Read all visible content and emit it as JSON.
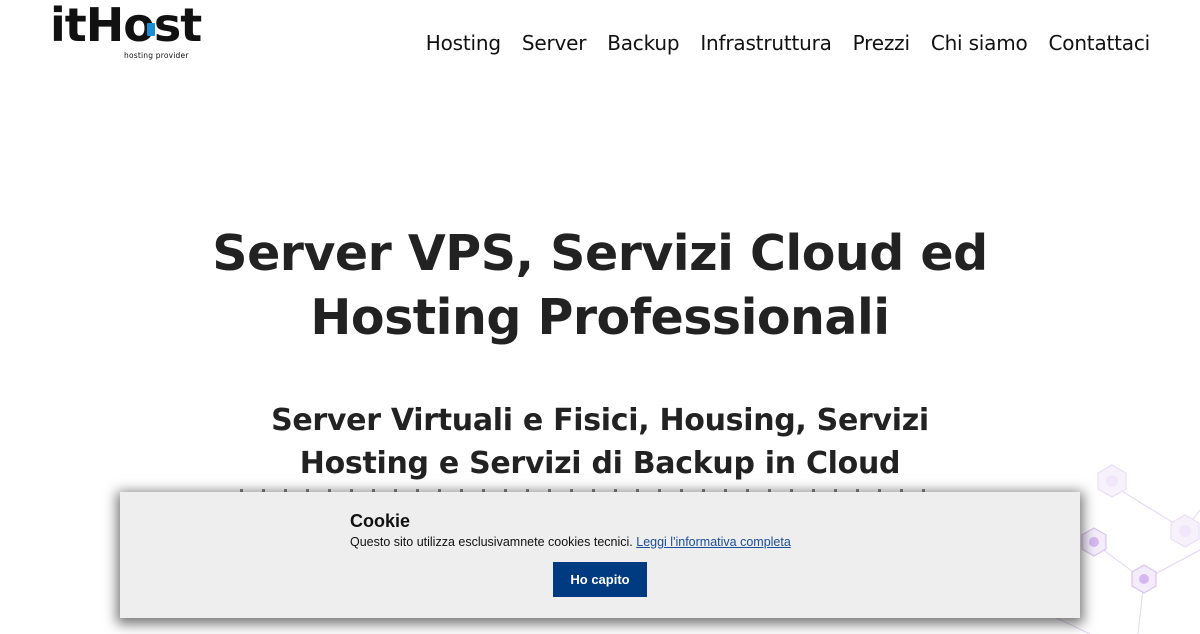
{
  "header": {
    "logo": {
      "wordmark": "itHost",
      "tagline": "hosting provider",
      "accent_color": "#1a8fd6"
    },
    "nav": [
      {
        "label": "Hosting"
      },
      {
        "label": "Server"
      },
      {
        "label": "Backup"
      },
      {
        "label": "Infrastruttura"
      },
      {
        "label": "Prezzi"
      },
      {
        "label": "Chi siamo"
      },
      {
        "label": "Contattaci"
      }
    ]
  },
  "hero": {
    "title_line1": "Server VPS, Servizi Cloud ed",
    "title_line2": "Hosting Professionali",
    "subtitle_line1": "Server Virtuali e Fisici, Housing, Servizi",
    "subtitle_line2": "Hosting e Servizi di Backup in Cloud"
  },
  "cookie_banner": {
    "title": "Cookie",
    "text": "Questo sito utilizza esclusivamnete cookies tecnici.",
    "link_label": "Leggi l'informativa completa",
    "button_label": "Ho capito",
    "button_color": "#003a80",
    "background_color": "#eeeeee"
  }
}
